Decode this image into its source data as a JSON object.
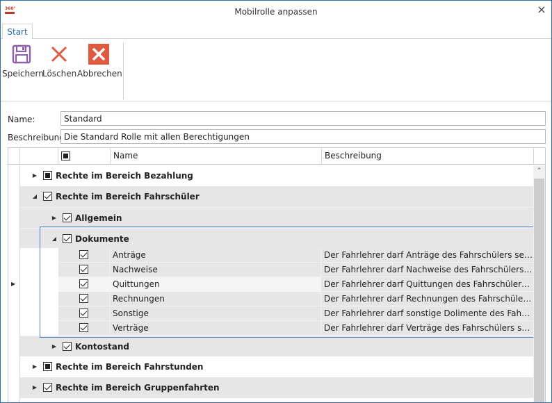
{
  "window": {
    "title": "Mobilrolle anpassen",
    "logo_text": "360°",
    "close_glyph": "×"
  },
  "tabs": [
    {
      "label": "Start"
    }
  ],
  "ribbon": {
    "save_label": "Speichern",
    "delete_label": "Löschen",
    "cancel_label": "Abbrechen"
  },
  "form": {
    "name_label": "Name:",
    "name_value": "Standard",
    "description_label": "Beschreibung",
    "description_value": "Die Standard Rolle mit allen Berechtigungen"
  },
  "grid": {
    "columns": {
      "name": "Name",
      "description": "Beschreibung"
    },
    "groups": {
      "bezahlung": "Rechte im Bereich Bezahlung",
      "fahrschueler": "Rechte im Bereich Fahrschüler",
      "allgemein": "Allgemein",
      "dokumente": "Dokumente",
      "kontostand": "Kontostand",
      "fahrstunden": "Rechte im Bereich Fahrstunden",
      "gruppenfahrten": "Rechte im Bereich Gruppenfahrten"
    },
    "items": [
      {
        "name": "Anträge",
        "description": "Der Fahrlehrer darf Anträge des Fahrschülers sehen"
      },
      {
        "name": "Nachweise",
        "description": "Der Fahrlehrer darf Nachweise des Fahrschülers sehen"
      },
      {
        "name": "Quittungen",
        "description": "Der Fahrlehrer darf Quittungen des Fahrschülers sehen"
      },
      {
        "name": "Rechnungen",
        "description": "Der Fahrlehrer darf Rechnungen des Fahrschülers sehen"
      },
      {
        "name": "Sonstige",
        "description": "Der Fahrlehrer darf sonstige Dolimente des Fahrschüle..."
      },
      {
        "name": "Verträge",
        "description": "Der Fahrlehrer darf Verträge des Fahrschülers sehen"
      }
    ]
  },
  "colors": {
    "accent": "#2b6fb5",
    "save_icon": "#8e5ea8",
    "delete_icon": "#e05a40",
    "cancel_icon": "#e05a40",
    "row_grey": "#e6e6e6",
    "selection_border": "#4a7fc1"
  },
  "icons": {
    "save": "floppy-disk-icon",
    "delete": "x-mark-icon",
    "cancel": "x-box-icon",
    "close": "close-icon",
    "expand": "triangle-right-icon",
    "collapse": "triangle-down-icon",
    "scroll_up": "chevron-up-icon",
    "row_pointer": "row-pointer-icon"
  }
}
